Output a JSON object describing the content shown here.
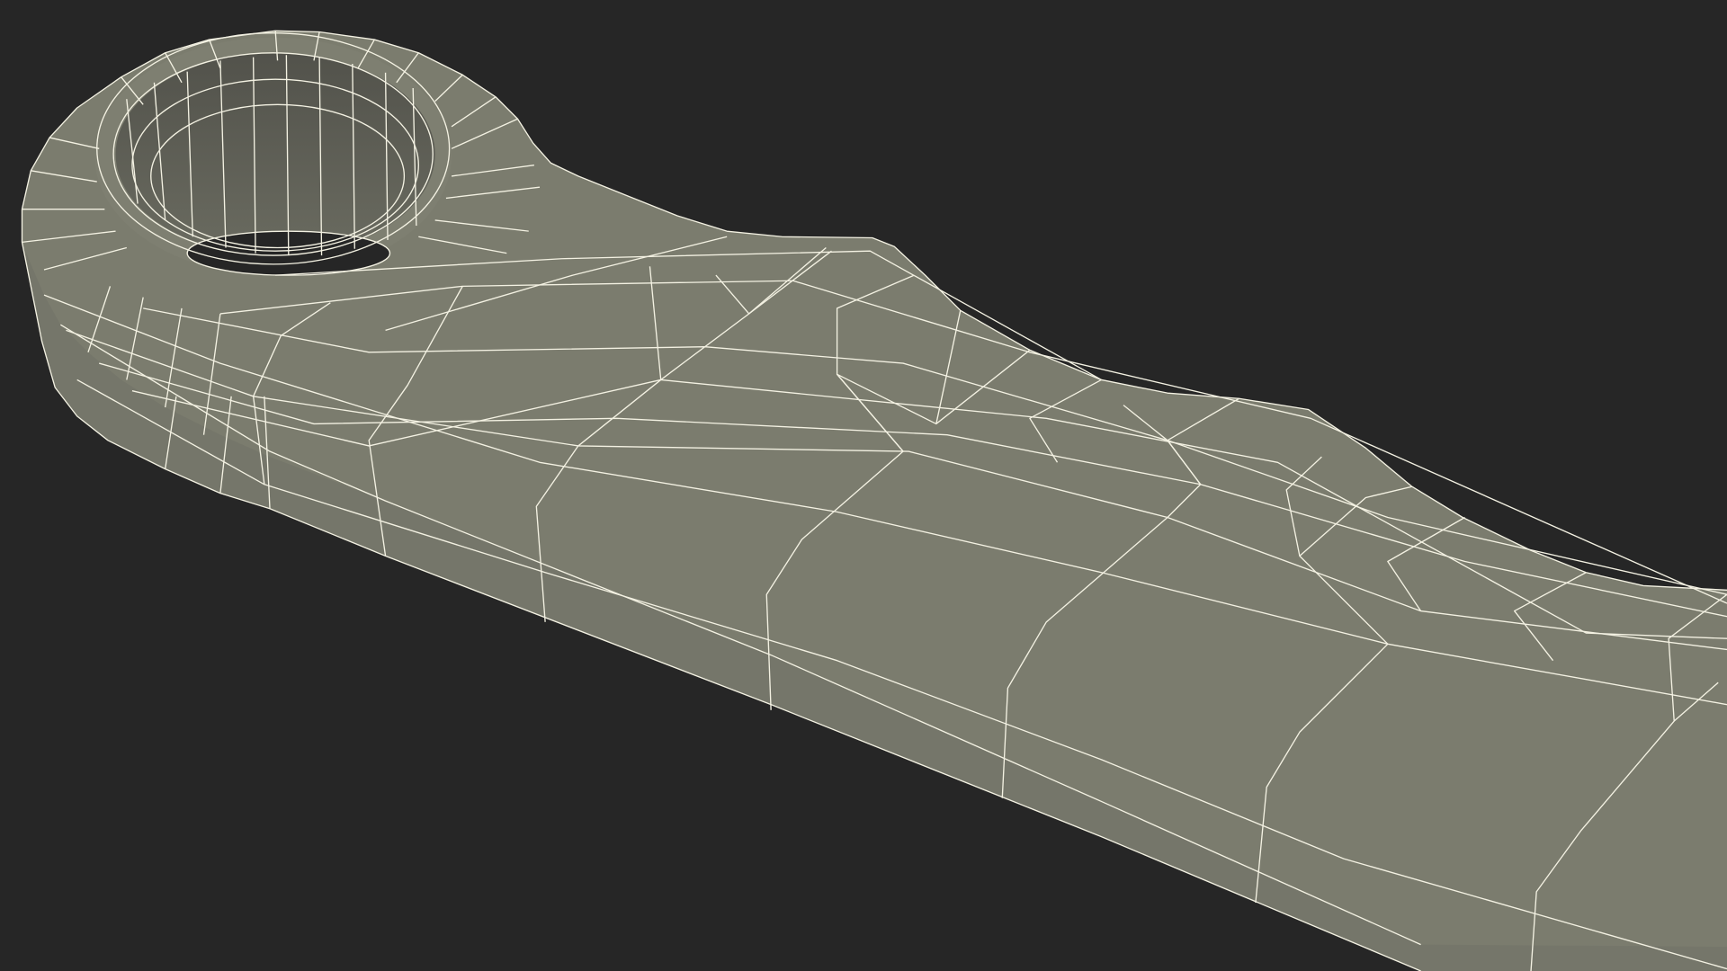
{
  "scene": {
    "subject": "wireframe-mesh-render",
    "colors": {
      "background": "#262626",
      "surface": "#7b7c6e",
      "surface_top": "#7e7f71",
      "surface_side": "#75766a",
      "hole_inner": "#5a5a52",
      "hole_inner_dark": "#4f4f48",
      "wire": "#f3f1e2"
    }
  }
}
